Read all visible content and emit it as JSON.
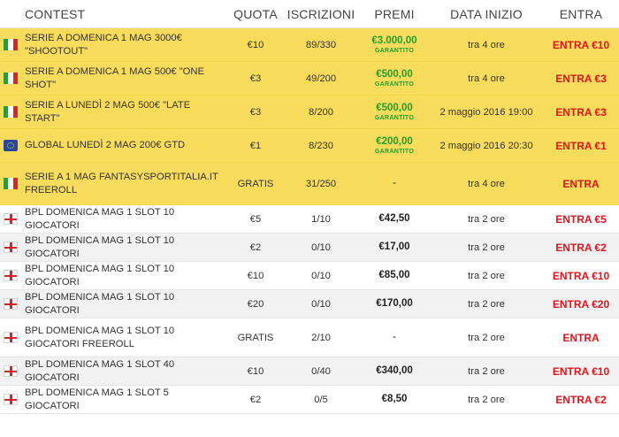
{
  "header": {
    "contest": "CONTEST",
    "quota": "QUOTA",
    "iscrizioni": "ISCRIZIONI",
    "premi": "PREMI",
    "data_inizio": "DATA INIZIO",
    "entra": "ENTRA"
  },
  "guarantee_label": "GARANTITO",
  "colors": {
    "featured": "#f9dc5c",
    "alt_row": "#f2f2f2",
    "entry": "#e0151d",
    "guarantee": "#1f9e2c"
  },
  "rows": [
    {
      "flag": "italy-flag-icon",
      "name": "SERIE A DOMENICA 1 MAG 3000€ \"SHOOTOUT\"",
      "quota": "€10",
      "iscrizioni": "89/330",
      "premi": "€3.000,00",
      "garantito": true,
      "data": "tra 4 ore",
      "entra": "ENTRA €10",
      "featured": true
    },
    {
      "flag": "italy-flag-icon",
      "name": "SERIE A DOMENICA 1 MAG 500€ \"ONE SHOT\"",
      "quota": "€3",
      "iscrizioni": "49/200",
      "premi": "€500,00",
      "garantito": true,
      "data": "tra 4 ore",
      "entra": "ENTRA €3",
      "featured": true
    },
    {
      "flag": "italy-flag-icon",
      "name": "SERIE A LUNEDÌ 2 MAG 500€ \"LATE START\"",
      "quota": "€3",
      "iscrizioni": "8/200",
      "premi": "€500,00",
      "garantito": true,
      "data": "2 maggio 2016 19:00",
      "entra": "ENTRA €3",
      "featured": true
    },
    {
      "flag": "europe-globe-icon",
      "name": "GLOBAL LUNEDÌ 2 MAG 200€ GTD",
      "quota": "€1",
      "iscrizioni": "8/230",
      "premi": "€200,00",
      "garantito": true,
      "data": "2 maggio 2016 20:30",
      "entra": "ENTRA €1",
      "featured": true
    },
    {
      "flag": "italy-flag-icon",
      "name": "SERIE A 1 MAG FANTASYSPORTITALIA.IT FREEROLL",
      "quota": "GRATIS",
      "iscrizioni": "31/250",
      "premi": "-",
      "garantito": false,
      "data": "tra 4 ore",
      "entra": "ENTRA",
      "featured": true
    },
    {
      "flag": "england-flag-icon",
      "name": "BPL DOMENICA MAG 1 SLOT 10 GIOCATORI",
      "quota": "€5",
      "iscrizioni": "1/10",
      "premi": "€42,50",
      "garantito": false,
      "data": "tra 2 ore",
      "entra": "ENTRA €5",
      "featured": false
    },
    {
      "flag": "england-flag-icon",
      "name": "BPL DOMENICA MAG 1 SLOT 10 GIOCATORI",
      "quota": "€2",
      "iscrizioni": "0/10",
      "premi": "€17,00",
      "garantito": false,
      "data": "tra 2 ore",
      "entra": "ENTRA €2",
      "featured": false
    },
    {
      "flag": "england-flag-icon",
      "name": "BPL DOMENICA MAG 1 SLOT 10 GIOCATORI",
      "quota": "€10",
      "iscrizioni": "0/10",
      "premi": "€85,00",
      "garantito": false,
      "data": "tra 2 ore",
      "entra": "ENTRA €10",
      "featured": false
    },
    {
      "flag": "england-flag-icon",
      "name": "BPL DOMENICA MAG 1 SLOT 10 GIOCATORI",
      "quota": "€20",
      "iscrizioni": "0/10",
      "premi": "€170,00",
      "garantito": false,
      "data": "tra 2 ore",
      "entra": "ENTRA €20",
      "featured": false
    },
    {
      "flag": "england-flag-icon",
      "name": "BPL DOMENICA MAG 1 SLOT 10 GIOCATORI FREEROLL",
      "quota": "GRATIS",
      "iscrizioni": "2/10",
      "premi": "-",
      "garantito": false,
      "data": "tra 2 ore",
      "entra": "ENTRA",
      "featured": false
    },
    {
      "flag": "england-flag-icon",
      "name": "BPL DOMENICA MAG 1 SLOT 40 GIOCATORI",
      "quota": "€10",
      "iscrizioni": "0/40",
      "premi": "€340,00",
      "garantito": false,
      "data": "tra 2 ore",
      "entra": "ENTRA €10",
      "featured": false
    },
    {
      "flag": "england-flag-icon",
      "name": "BPL DOMENICA MAG 1 SLOT 5 GIOCATORI",
      "quota": "€2",
      "iscrizioni": "0/5",
      "premi": "€8,50",
      "garantito": false,
      "data": "tra 2 ore",
      "entra": "ENTRA €2",
      "featured": false
    }
  ]
}
